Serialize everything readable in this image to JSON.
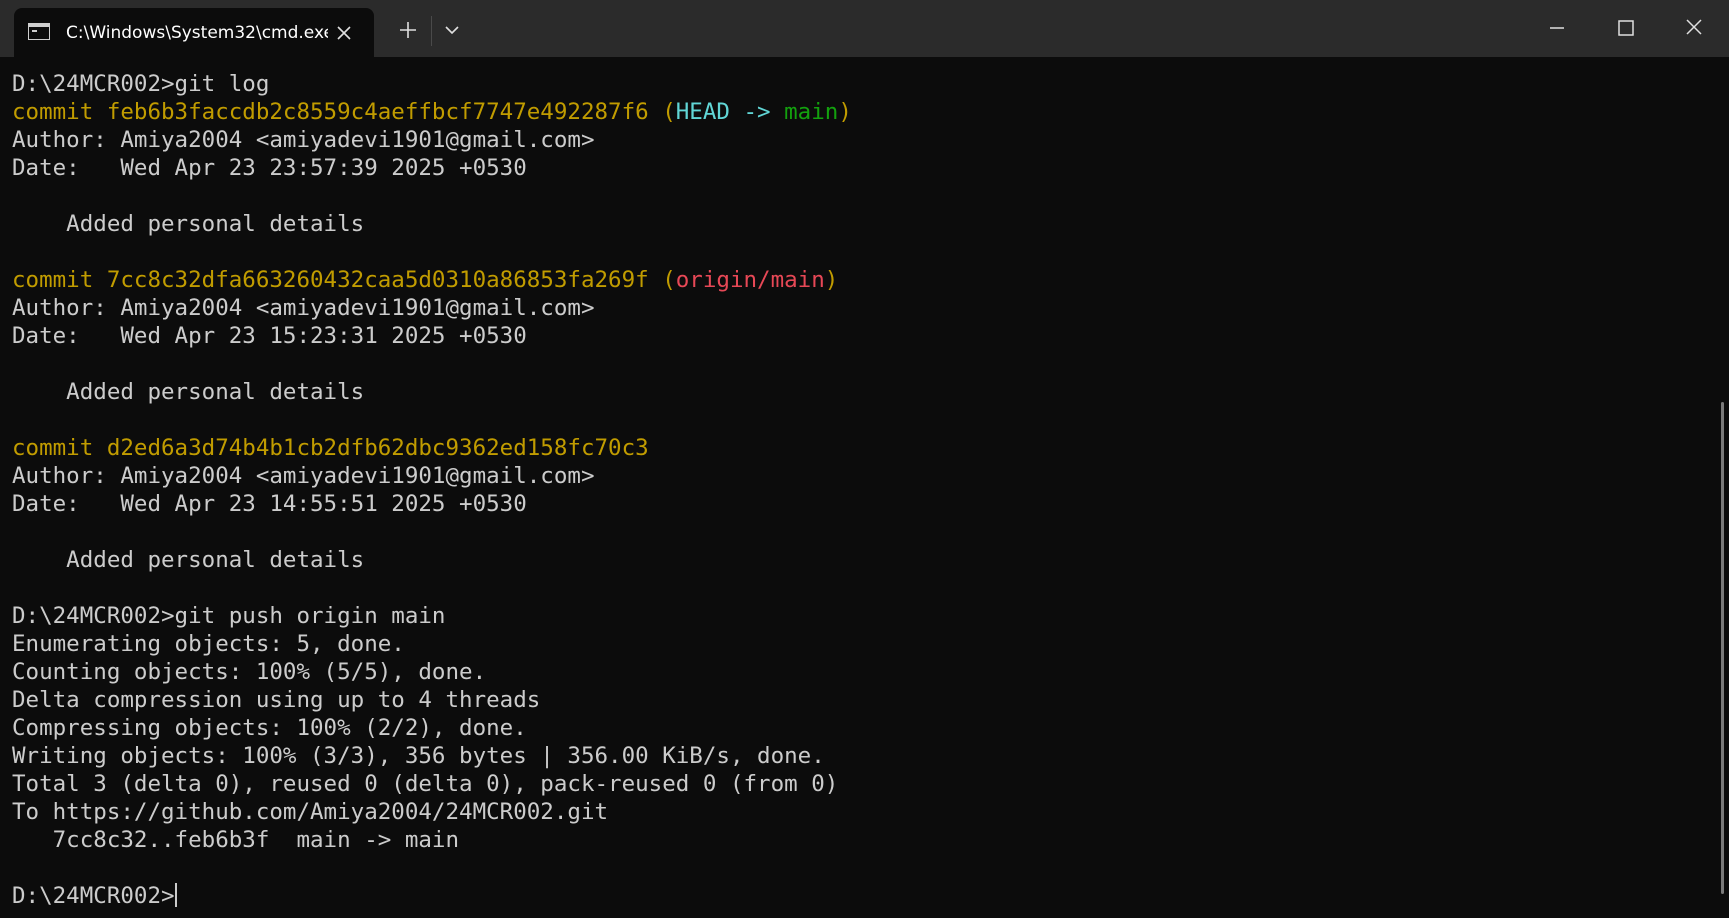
{
  "tab": {
    "title": "C:\\Windows\\System32\\cmd.exe",
    "icon": "terminal-icon"
  },
  "titlebar": {
    "new_tab_icon": "plus-icon",
    "dropdown_icon": "chevron-down-icon",
    "minimize_icon": "minimize-icon",
    "maximize_icon": "maximize-icon",
    "close_icon": "close-icon"
  },
  "colors": {
    "background": "#0c0c0c",
    "text": "#cccccc",
    "commit_yellow": "#c19c00",
    "head_cyan": "#61d6d6",
    "branch_green": "#13a10e",
    "remote_red": "#e74856"
  },
  "terminal": {
    "lines": [
      [
        {
          "t": "D:\\24MCR002>git log"
        }
      ],
      [
        {
          "t": "commit feb6b3faccdb2c8559c4aeffbcf7747e492287f6 (",
          "c": "yellow"
        },
        {
          "t": "HEAD -> ",
          "c": "cyan"
        },
        {
          "t": "main",
          "c": "green"
        },
        {
          "t": ")",
          "c": "yellow"
        }
      ],
      [
        {
          "t": "Author: Amiya2004 <amiyadevi1901@gmail.com>"
        }
      ],
      [
        {
          "t": "Date:   Wed Apr 23 23:57:39 2025 +0530"
        }
      ],
      [
        {
          "t": ""
        }
      ],
      [
        {
          "t": "    Added personal details"
        }
      ],
      [
        {
          "t": ""
        }
      ],
      [
        {
          "t": "commit 7cc8c32dfa663260432caa5d0310a86853fa269f (",
          "c": "yellow"
        },
        {
          "t": "origin/main",
          "c": "red"
        },
        {
          "t": ")",
          "c": "yellow"
        }
      ],
      [
        {
          "t": "Author: Amiya2004 <amiyadevi1901@gmail.com>"
        }
      ],
      [
        {
          "t": "Date:   Wed Apr 23 15:23:31 2025 +0530"
        }
      ],
      [
        {
          "t": ""
        }
      ],
      [
        {
          "t": "    Added personal details"
        }
      ],
      [
        {
          "t": ""
        }
      ],
      [
        {
          "t": "commit d2ed6a3d74b4b1cb2dfb62dbc9362ed158fc70c3",
          "c": "yellow"
        }
      ],
      [
        {
          "t": "Author: Amiya2004 <amiyadevi1901@gmail.com>"
        }
      ],
      [
        {
          "t": "Date:   Wed Apr 23 14:55:51 2025 +0530"
        }
      ],
      [
        {
          "t": ""
        }
      ],
      [
        {
          "t": "    Added personal details"
        }
      ],
      [
        {
          "t": ""
        }
      ],
      [
        {
          "t": "D:\\24MCR002>git push origin main"
        }
      ],
      [
        {
          "t": "Enumerating objects: 5, done."
        }
      ],
      [
        {
          "t": "Counting objects: 100% (5/5), done."
        }
      ],
      [
        {
          "t": "Delta compression using up to 4 threads"
        }
      ],
      [
        {
          "t": "Compressing objects: 100% (2/2), done."
        }
      ],
      [
        {
          "t": "Writing objects: 100% (3/3), 356 bytes | 356.00 KiB/s, done."
        }
      ],
      [
        {
          "t": "Total 3 (delta 0), reused 0 (delta 0), pack-reused 0 (from 0)"
        }
      ],
      [
        {
          "t": "To https://github.com/Amiya2004/24MCR002.git"
        }
      ],
      [
        {
          "t": "   7cc8c32..feb6b3f  main -> main"
        }
      ],
      [
        {
          "t": ""
        }
      ],
      [
        {
          "t": "D:\\24MCR002>"
        }
      ]
    ]
  }
}
